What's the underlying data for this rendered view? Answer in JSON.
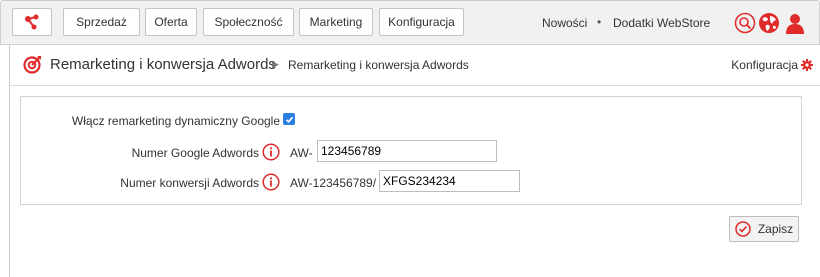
{
  "topnav": {
    "items": [
      "Sprzedaż",
      "Oferta",
      "Społeczność",
      "Marketing",
      "Konfiguracja"
    ],
    "links": [
      "Nowości",
      "Dodatki WebStore"
    ],
    "separator": "•",
    "icons": [
      "share-logo-icon",
      "search-icon",
      "globe-icon",
      "user-icon"
    ]
  },
  "header": {
    "title": "Remarketing i konwersja Adwords",
    "breadcrumb_arrow": "▶",
    "breadcrumb_current": "Remarketing i konwersja Adwords",
    "config_label": "Konfiguracja",
    "title_icon": "target-icon",
    "config_icon": "gear-icon"
  },
  "form": {
    "remarketing_label": "Włącz remarketing dynamiczny Google",
    "remarketing_checked": true,
    "google_number_label": "Numer Google Adwords",
    "google_number_prefix": "AW-",
    "google_number_value": "123456789",
    "conversion_label": "Numer konwersji Adwords",
    "conversion_prefix": "AW-123456789/",
    "conversion_value": "XFGS234234",
    "info_icon": "info-icon"
  },
  "actions": {
    "save_label": "Zapisz",
    "save_icon": "check-circle-icon"
  },
  "colors": {
    "accent": "#e02b2b",
    "checkbox": "#2a7de1",
    "topbar_bg": "#f1f1f1"
  }
}
